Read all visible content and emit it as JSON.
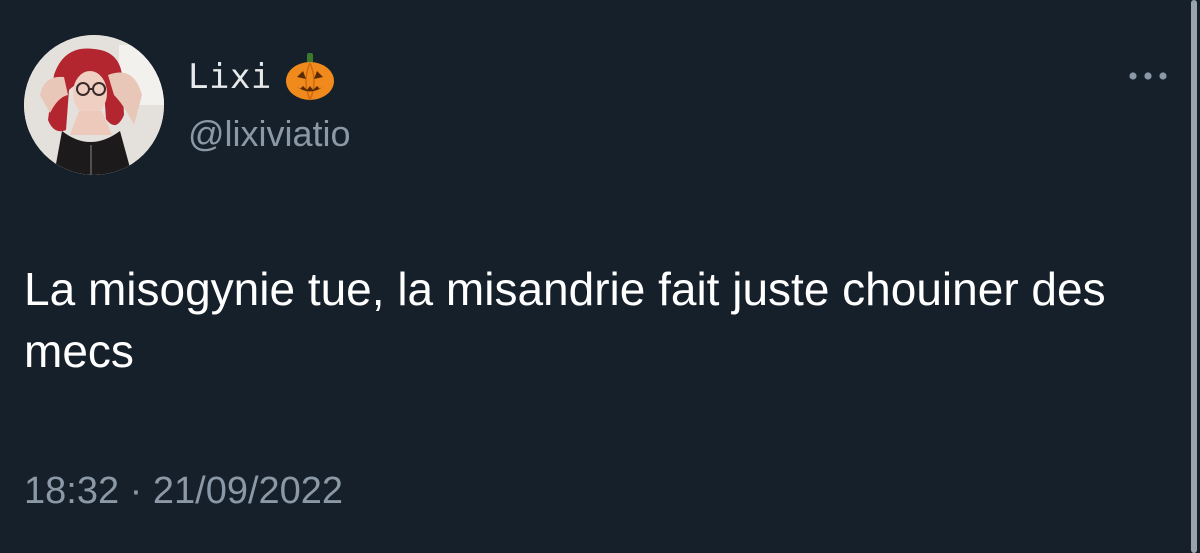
{
  "colors": {
    "background": "#15202b",
    "primary_text": "#ffffff",
    "secondary_text": "#8b98a5",
    "pumpkin": "#f08a1c"
  },
  "author": {
    "display_name": "Lixi",
    "badge_icon": "jack-o-lantern-icon",
    "handle": "@lixiviatio",
    "avatar_icon": "profile-photo"
  },
  "menu": {
    "icon": "more-horizontal-icon"
  },
  "tweet": {
    "text": "La misogynie tue, la misandrie fait juste chouiner des mecs",
    "timestamp": "18:32 · 21/09/2022"
  }
}
